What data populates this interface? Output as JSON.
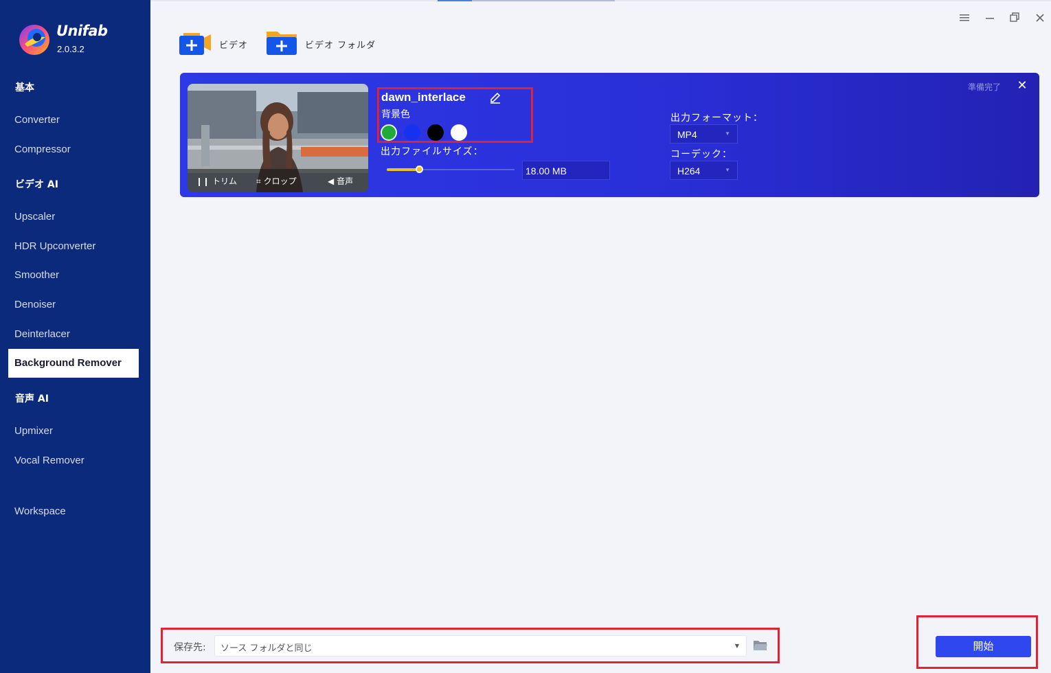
{
  "app": {
    "name": "Unifab",
    "version": "2.0.3.2"
  },
  "sidebar": {
    "sections": [
      {
        "label": "基本"
      },
      {
        "label": "ビデオ AI"
      },
      {
        "label": "音声 AI"
      }
    ],
    "items": [
      {
        "label": "Converter"
      },
      {
        "label": "Compressor"
      },
      {
        "label": "Upscaler"
      },
      {
        "label": "HDR Upconverter"
      },
      {
        "label": "Smoother"
      },
      {
        "label": "Denoiser"
      },
      {
        "label": "Deinterlacer"
      },
      {
        "label": "Background Remover",
        "active": true
      },
      {
        "label": "Upmixer"
      },
      {
        "label": "Vocal Remover"
      },
      {
        "label": "Workspace"
      }
    ]
  },
  "toolbar": {
    "add_video_label": "ビデオ",
    "add_folder_label": "ビデオ フォルダ"
  },
  "file": {
    "name": "dawn_interlace",
    "bg_color_label": "背景色",
    "bg_colors": [
      "#1faa3a",
      "#1631f0",
      "#000000",
      "#ffffff"
    ],
    "trim_label": "トリム",
    "crop_label": "クロップ",
    "audio_label": "音声",
    "output_size_label": "出力ファイルサイズ：",
    "output_size_value": "18.00 MB",
    "output_size_slider": 0.25,
    "format_label": "出力フォーマット：",
    "format_value": "MP4",
    "codec_label": "コーデック：",
    "codec_value": "H264",
    "status": "準備完了"
  },
  "footer": {
    "save_label": "保存先:",
    "save_value": "ソース フォルダと同じ",
    "start_label": "開始"
  },
  "colors": {
    "sidebar": "#0c2a7b",
    "card": "#2d39e6",
    "highlight": "#e02233",
    "start_button": "#2f47ee"
  }
}
